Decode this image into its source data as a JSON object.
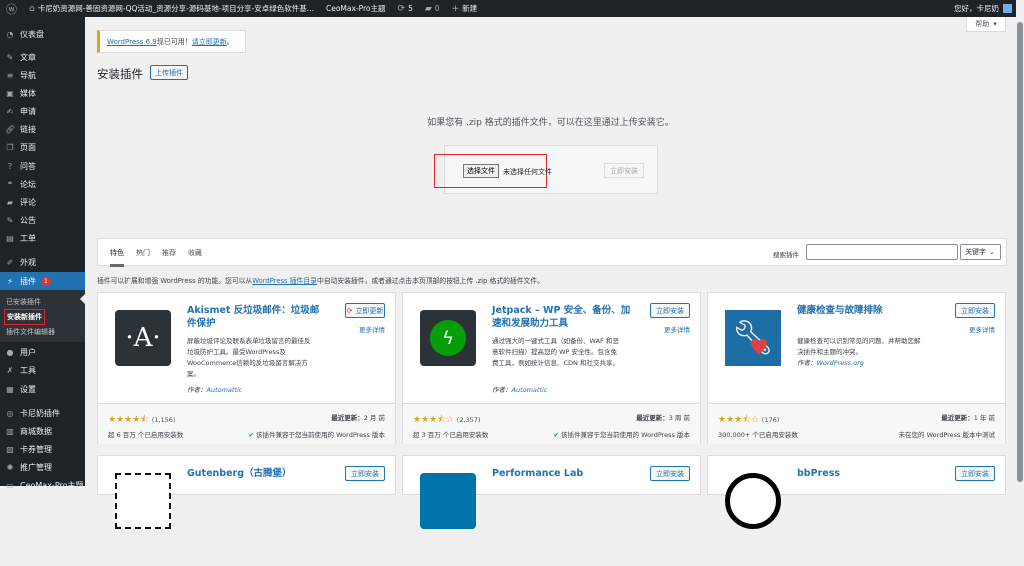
{
  "adminbar": {
    "site_title": "卡尼奶资源网-善固资源网-QQ活动_资源分享-源码基地-项目分享-安卓绿色软件基...",
    "theme": "CeoMax-Pro主题",
    "updates": "5",
    "comments": "0",
    "new": "新建",
    "greeting": "您好，卡尼奶"
  },
  "sidebar": {
    "items": [
      {
        "label": "仪表盘",
        "icon": "dashboard-icon"
      },
      {
        "label": "文章",
        "icon": "pin-icon"
      },
      {
        "label": "导航",
        "icon": "menu-icon"
      },
      {
        "label": "媒体",
        "icon": "media-icon"
      },
      {
        "label": "申请",
        "icon": "edit-icon"
      },
      {
        "label": "链接",
        "icon": "link-icon"
      },
      {
        "label": "页面",
        "icon": "page-icon"
      },
      {
        "label": "问答",
        "icon": "question-icon"
      },
      {
        "label": "论坛",
        "icon": "forum-icon"
      },
      {
        "label": "评论",
        "icon": "comment-icon"
      },
      {
        "label": "公告",
        "icon": "pin-icon"
      },
      {
        "label": "工单",
        "icon": "ticket-icon"
      },
      {
        "label": "外观",
        "icon": "brush-icon"
      },
      {
        "label": "插件",
        "icon": "plugin-icon",
        "badge": "1"
      },
      {
        "label": "用户",
        "icon": "user-icon"
      },
      {
        "label": "工具",
        "icon": "wrench-icon"
      },
      {
        "label": "设置",
        "icon": "settings-icon"
      },
      {
        "label": "卡尼奶插件",
        "icon": "plugin-custom-icon"
      },
      {
        "label": "商城数据",
        "icon": "store-icon"
      },
      {
        "label": "卡券管理",
        "icon": "card-icon"
      },
      {
        "label": "推广管理",
        "icon": "promo-icon"
      },
      {
        "label": "CeoMax-Pro主题",
        "icon": "theme-icon"
      }
    ],
    "submenu": [
      "已安装插件",
      "安装新插件",
      "插件文件编辑器"
    ]
  },
  "notice": {
    "link": "WordPress 6.9",
    "text": " 现已可用！",
    "action": "请立即更新",
    "end": "。"
  },
  "help": "帮助",
  "page": {
    "title": "安装插件",
    "upload_button": "上传插件",
    "upload_msg": "如果您有 .zip 格式的插件文件，可以在这里通过上传安装它。",
    "choose_file": "选择文件",
    "no_file": "未选择任何文件",
    "install_now": "立即安装"
  },
  "filter": {
    "tabs": [
      "特色",
      "热门",
      "推荐",
      "收藏"
    ],
    "search_label": "搜索插件",
    "search_value": "",
    "search_type": "关键字"
  },
  "desc": {
    "pre": "插件可以扩展和增强 WordPress 的功能。您可以从",
    "link": "WordPress 插件目录",
    "post": "中自动安装插件，或者通过点击本页顶部的按钮上传 .zip 格式的插件文件。"
  },
  "plugins": [
    {
      "name": "Akismet 反垃圾邮件：垃圾邮件保护",
      "action": "立即更新",
      "more": "更多详情",
      "desc": "屏蔽垃圾评论及联系表单垃圾留言的最佳反垃圾防护工具。最受WordPress及WooCommerce信赖的反垃圾留言解决方案。",
      "author_label": "作者：",
      "author": "Automattic",
      "rating": 4.5,
      "stars": "★★★★⯪",
      "count": "(1,156)",
      "installs": "超 6 百万 个已启用安装数",
      "updated_label": "最近更新：",
      "updated": "2 月 前",
      "compat": "该插件兼容于您当前使用的 WordPress 版本"
    },
    {
      "name": "Jetpack – WP 安全、备份、加速和发展助力工具",
      "action": "立即安装",
      "more": "更多详情",
      "desc": "通过强大的一键式工具（如备份、WAF 和恶意软件扫描）提高您的 WP 安全性。包含免费工具，例如统计信息、CDN 和社交共享。",
      "author_label": "作者：",
      "author": "Automattic",
      "rating": 3.5,
      "stars": "★★★⯪☆",
      "count": "(2,357)",
      "installs": "超 3 百万 个已启用安装数",
      "updated_label": "最近更新：",
      "updated": "3 周 前",
      "compat": "该插件兼容于您当前使用的 WordPress 版本"
    },
    {
      "name": "健康检查与故障排除",
      "action": "立即安装",
      "more": "更多详情",
      "desc": "健康检查可以识别常见的问题，并帮助您解决插件和主题的冲突。",
      "author_label": "作者：",
      "author": "WordPress.org",
      "rating": 3.5,
      "stars": "★★★⯪☆",
      "count": "(176)",
      "installs": "300,000+ 个已启用安装数",
      "updated_label": "最近更新：",
      "updated": "1 年 前",
      "compat": "未在您的 WordPress 版本中测试"
    },
    {
      "name": "Gutenberg（古腾堡）",
      "action": "立即安装"
    },
    {
      "name": "Performance Lab",
      "action": "立即安装"
    },
    {
      "name": "bbPress",
      "action": "立即安装"
    }
  ],
  "colors": {
    "adminbar": "#1d2327",
    "accent": "#2271b1",
    "highlight_box": "#e3222b",
    "star": "#dba617"
  }
}
